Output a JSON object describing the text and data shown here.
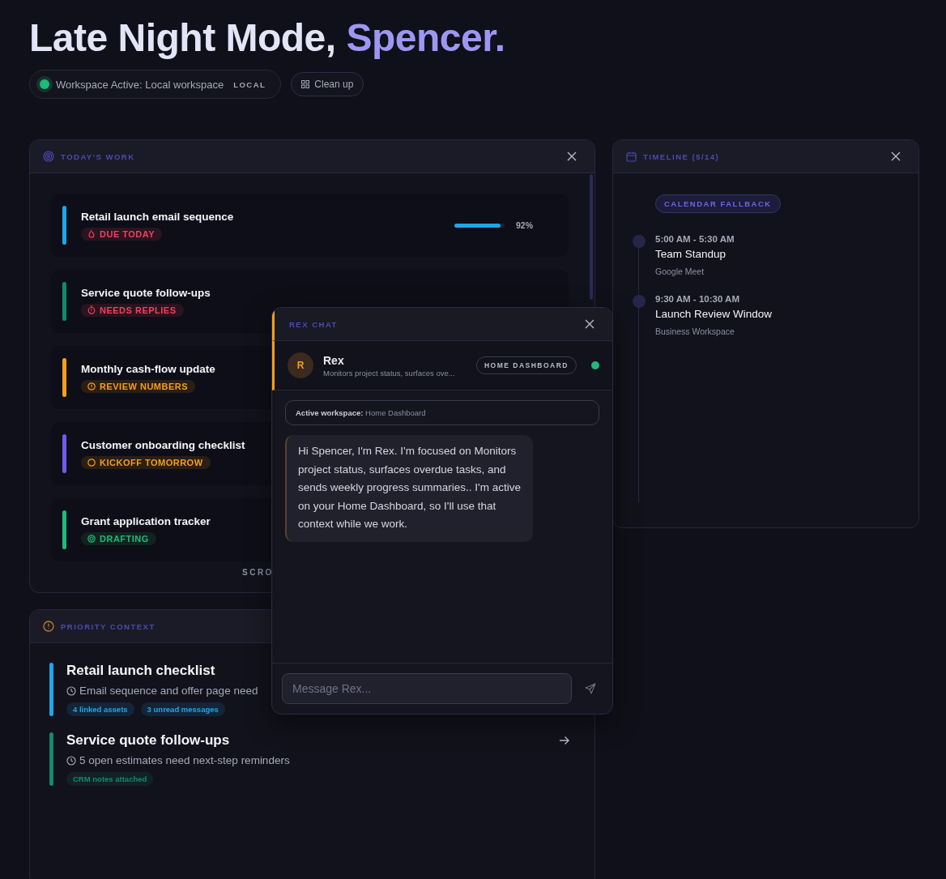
{
  "greeting": {
    "lead": "Late Night Mode, ",
    "name": "Spencer."
  },
  "workspace": {
    "label": "Workspace Active: Local workspace",
    "tag": "LOCAL",
    "active": true
  },
  "cleanup_button": "Clean up",
  "todays_work": {
    "title": "TODAY'S WORK",
    "footer": "SCRO",
    "tasks": [
      {
        "title": "Retail launch email sequence",
        "status": "DUE TODAY",
        "kind": "flame",
        "color": "#1ea7e8",
        "progress": {
          "level": 0.92,
          "reading": "92%"
        }
      },
      {
        "title": "Service quote follow-ups",
        "status": "NEEDS REPLIES",
        "kind": "timer",
        "color": "#14896e"
      },
      {
        "title": "Monthly cash-flow update",
        "status": "REVIEW NUMBERS",
        "kind": "alert",
        "color": "#f59e1b"
      },
      {
        "title": "Customer onboarding checklist",
        "status": "KICKOFF TOMORROW",
        "kind": "circle",
        "color": "#6d5bea"
      },
      {
        "title": "Grant application tracker",
        "status": "DRAFTING",
        "kind": "target",
        "color": "#1fba7c"
      }
    ]
  },
  "priority_context": {
    "title": "PRIORITY CONTEXT",
    "items": [
      {
        "title": "Retail launch checklist",
        "detail": "Email sequence and offer page need",
        "color": "#1ea7e8",
        "tags": [
          "4 linked assets",
          "3 unread messages"
        ]
      },
      {
        "title": "Service quote follow-ups",
        "detail": "5 open estimates need next-step reminders",
        "color": "#14896e",
        "tags": [
          "CRM notes attached"
        ],
        "arrow": true
      }
    ]
  },
  "timeline": {
    "title": "TIMELINE (5/14)",
    "badge": "CALENDAR FALLBACK",
    "events": [
      {
        "time": "5:00 AM - 5:30 AM",
        "title": "Team Standup",
        "place": "Google Meet"
      },
      {
        "time": "9:30 AM - 10:30 AM",
        "title": "Launch Review Window",
        "place": "Business Workspace"
      }
    ]
  },
  "chat": {
    "title": "REX CHAT",
    "agent": {
      "initial": "R",
      "name": "Rex",
      "summary": "Monitors project status, surfaces ove...",
      "workspace_tag": "HOME DASHBOARD",
      "online": true
    },
    "context": "**Active workspace:** Home Dashboard",
    "messages": [
      "Hi Spencer, I'm Rex. I'm focused on Monitors project status, surfaces overdue tasks, and sends weekly progress summaries.. I'm active on your Home Dashboard, so I'll use that context while we work."
    ],
    "input": {
      "placeholder": "Message Rex..."
    }
  }
}
